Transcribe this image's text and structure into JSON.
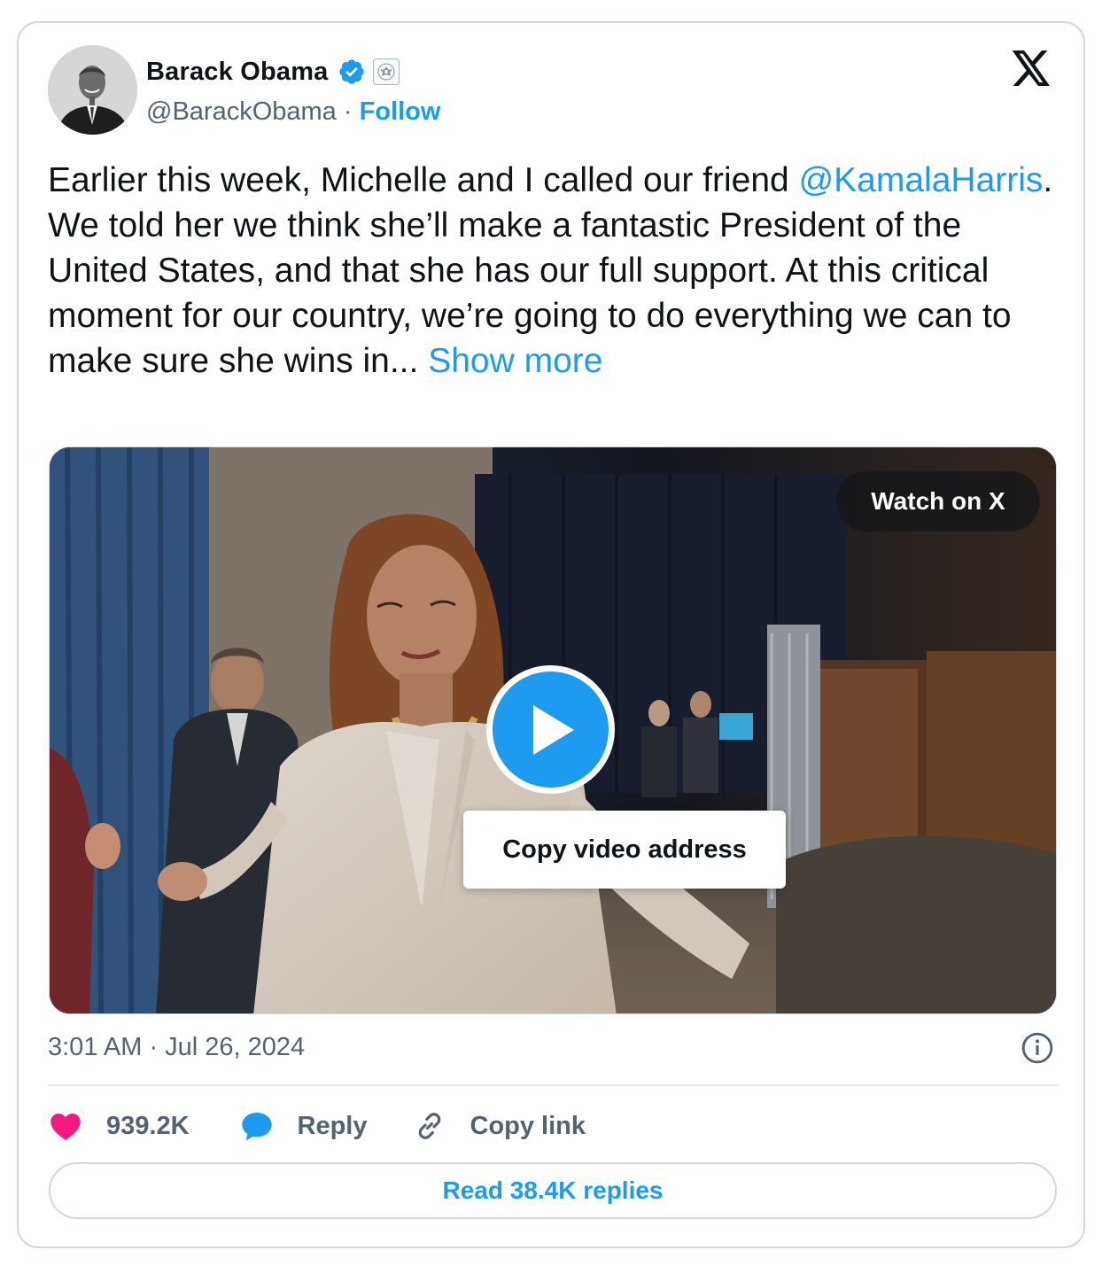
{
  "author": {
    "name": "Barack Obama",
    "handle": "@BarackObama",
    "separator": "·",
    "follow_label": "Follow"
  },
  "tweet": {
    "text_before_mention": "Earlier this week, Michelle and I called our friend ",
    "mention": "@KamalaHarris",
    "text_after_mention": ". We told her we think she’ll make a fantastic President of the United States, and that she has our full support. At this critical moment for our country, we’re going to do everything we can to make sure she wins in...",
    "show_more_label": "Show more"
  },
  "media": {
    "watch_label": "Watch on X",
    "context_menu_item": "Copy video address"
  },
  "timestamp": "3:01 AM · Jul 26, 2024",
  "actions": {
    "likes_count": "939.2K",
    "reply_label": "Reply",
    "copy_link_label": "Copy link"
  },
  "read_replies_label": "Read 38.4K replies",
  "icons": {
    "verified": "verified-badge-icon",
    "affiliation": "government-seal-icon",
    "brand": "x-logo-icon",
    "info": "info-icon",
    "like": "heart-icon",
    "reply": "speech-bubble-icon",
    "link": "link-icon",
    "play": "play-icon"
  },
  "colors": {
    "accent": "#1d9bf0",
    "like": "#f91880",
    "text_primary": "#0f1419",
    "text_secondary": "#536471",
    "border": "#cfd9de"
  }
}
